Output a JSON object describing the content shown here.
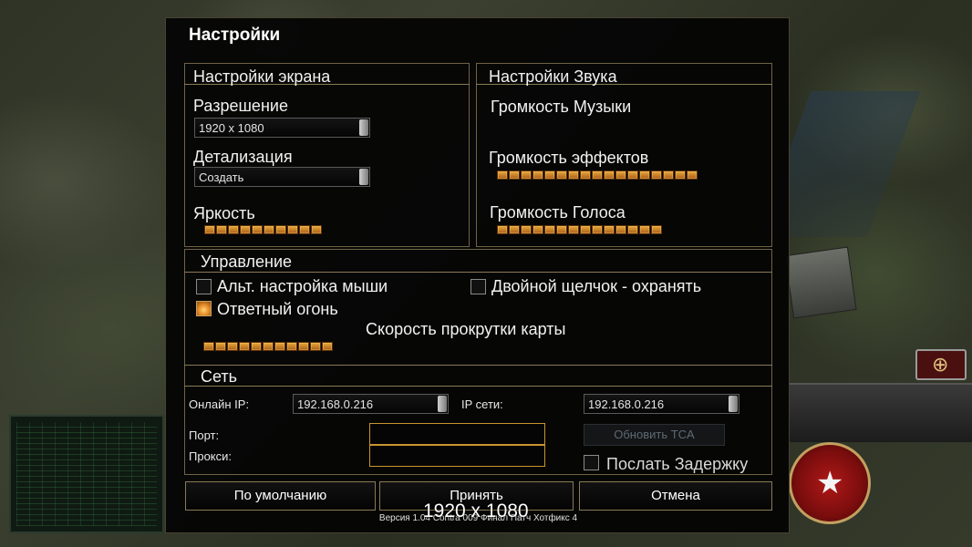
{
  "title": "Настройки",
  "screen": {
    "header": "Настройки экрана",
    "resolution_label": "Разрешение",
    "resolution_value": "1920 x 1080",
    "detail_label": "Детализация",
    "detail_value": "Создать",
    "brightness_label": "Яркость",
    "brightness_level": 1.0
  },
  "sound": {
    "header": "Настройки Звука",
    "music_label": "Громкость Музыки",
    "music_level": 0,
    "effects_label": "Громкость эффектов",
    "effects_level": 1.0,
    "voice_label": "Громкость Голоса",
    "voice_level": 1.0
  },
  "control": {
    "header": "Управление",
    "alt_mouse_label": "Альт. настройка мыши",
    "alt_mouse_checked": false,
    "double_click_label": "Двойной щелчок - охранять",
    "double_click_checked": false,
    "return_fire_label": "Ответный огонь",
    "return_fire_checked": true,
    "scroll_speed_label": "Скорость прокрутки карты",
    "scroll_speed_level": 1.0
  },
  "network": {
    "header": "Сеть",
    "online_ip_label": "Онлайн IP:",
    "online_ip_value": "192.168.0.216",
    "lan_ip_label": "IP сети:",
    "lan_ip_value": "192.168.0.216",
    "port_label": "Порт:",
    "port_value": "",
    "proxy_label": "Прокси:",
    "proxy_value": "",
    "update_tca_label": "Обновить TCA",
    "send_delay_label": "Послать Задержку",
    "send_delay_checked": false
  },
  "buttons": {
    "default_label": "По умолчанию",
    "accept_label": "Принять",
    "cancel_label": "Отмена"
  },
  "version_text": "Версия 1.04 Contra 009 Финал Патч Хотфикс 4",
  "overlay_resolution": "1920 x 1080",
  "colors": {
    "accent_border": "#8a7a55",
    "slider_segment": "#e9a83a",
    "textbox_border": "#c9952f"
  }
}
